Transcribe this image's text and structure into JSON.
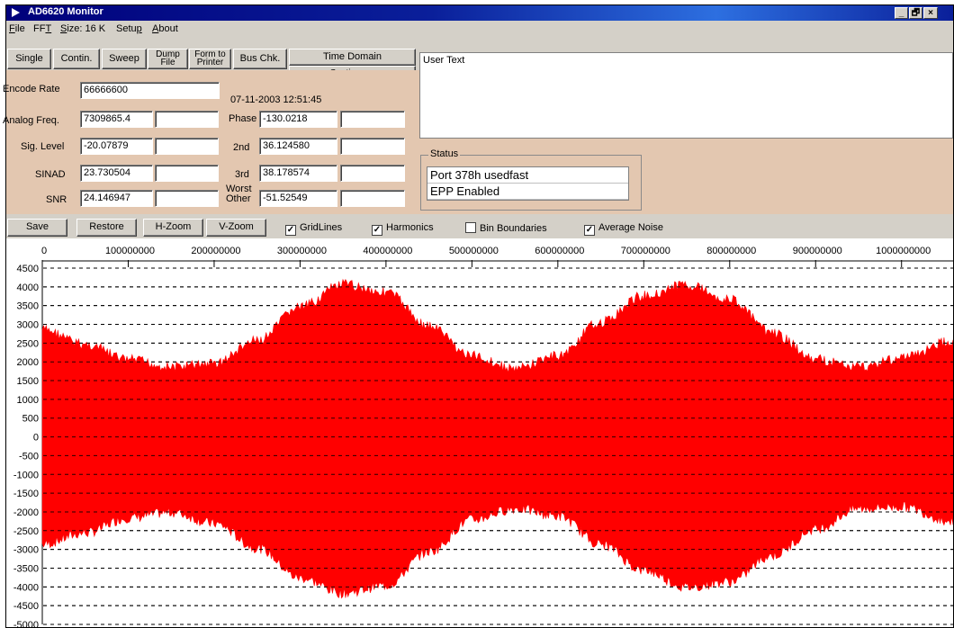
{
  "window": {
    "title": "AD6620 Monitor",
    "controls": [
      "_",
      "🗗",
      "×"
    ]
  },
  "menu": {
    "items": [
      {
        "label": "File",
        "underline": "F"
      },
      {
        "label": "FFT",
        "underline": "T"
      },
      {
        "label": "Size: 16 K",
        "underline": "S"
      },
      {
        "label": "Setup",
        "underline": "p"
      },
      {
        "label": "About",
        "underline": "A"
      }
    ]
  },
  "toolbar": {
    "single": "Single",
    "contin": "Contin.",
    "sweep": "Sweep",
    "dump_line1": "Dump",
    "dump_line2": "File",
    "form_line1": "Form to",
    "form_line2": "Printer",
    "bus_chk": "Bus Chk.",
    "time_domain": "Time Domain",
    "continuous": "Continuous"
  },
  "params": {
    "encode_rate_label": "Encode Rate",
    "encode_rate_value": "66666600",
    "timestamp": "07-11-2003  12:51:45",
    "analog_freq_label": "Analog Freq.",
    "analog_freq_value": "7309865.4",
    "analog_freq_value2": "",
    "phase_label": "Phase",
    "phase_value": "-130.0218",
    "phase_value2": "",
    "sig_level_label": "Sig. Level",
    "sig_level_value": "-20.07879",
    "sig_level_value2": "",
    "second_label": "2nd",
    "second_value": "36.124580",
    "second_value2": "",
    "sinad_label": "SINAD",
    "sinad_value": "23.730504",
    "sinad_value2": "",
    "third_label": "3rd",
    "third_value": "38.178574",
    "third_value2": "",
    "snr_label": "SNR",
    "snr_value": "24.146947",
    "snr_value2": "",
    "worst_label_line1": "Worst",
    "worst_label_line2": "Other",
    "worst_value": "-51.52549",
    "worst_value2": ""
  },
  "user_text": "User Text",
  "status": {
    "title": "Status",
    "lines": [
      "Port 378h usedfast",
      "EPP Enabled"
    ]
  },
  "chart_toolbar": {
    "save": "Save",
    "restore": "Restore",
    "h_zoom": "H-Zoom",
    "v_zoom": "V-Zoom",
    "checkboxes": [
      {
        "label": "GridLines",
        "checked": true
      },
      {
        "label": "Harmonics",
        "checked": true
      },
      {
        "label": "Bin Boundaries",
        "checked": false
      },
      {
        "label": "Average Noise",
        "checked": true
      }
    ]
  },
  "chart_data": {
    "type": "area",
    "title": "",
    "xlabel": "",
    "ylabel": "",
    "xlim": [
      0,
      1060000000
    ],
    "ylim": [
      -5000,
      4500
    ],
    "x_ticks": [
      0,
      100000000,
      200000000,
      300000000,
      400000000,
      500000000,
      600000000,
      700000000,
      800000000,
      900000000,
      1000000000
    ],
    "x_tick_labels": [
      "0",
      "100000000",
      "200000000",
      "300000000",
      "400000000",
      "500000000",
      "600000000",
      "700000000",
      "800000000",
      "900000000",
      "1000000000"
    ],
    "y_ticks": [
      4500,
      4000,
      3500,
      3000,
      2500,
      2000,
      1500,
      1000,
      500,
      0,
      -500,
      -1000,
      -1500,
      -2000,
      -2500,
      -3000,
      -3500,
      -4000,
      -4500,
      -5000
    ],
    "y_tick_labels": [
      "4500",
      "4000",
      "3500",
      "3000",
      "2500",
      "2000",
      "1500",
      "1000",
      "500",
      "0",
      "-500",
      "-1000",
      "-1500",
      "-2000",
      "-2500",
      "-3000",
      "-3500",
      "-4000",
      "-4500",
      "-5000"
    ],
    "grid": true,
    "series": [
      {
        "color": "#ff0000",
        "x": [
          0,
          50000000,
          100000000,
          150000000,
          200000000,
          250000000,
          300000000,
          350000000,
          400000000,
          450000000,
          500000000,
          550000000,
          600000000,
          650000000,
          700000000,
          750000000,
          800000000,
          850000000,
          900000000,
          950000000,
          1000000000,
          1060000000
        ],
        "upper": [
          3000,
          2600,
          2200,
          2000,
          2100,
          2700,
          3600,
          4200,
          4000,
          3100,
          2300,
          1950,
          2300,
          3200,
          3900,
          4200,
          3800,
          2900,
          2200,
          2000,
          2250,
          2700
        ],
        "lower": [
          -3000,
          -2700,
          -2300,
          -2150,
          -2450,
          -3100,
          -3900,
          -4300,
          -4100,
          -3200,
          -2350,
          -2050,
          -2250,
          -3000,
          -3700,
          -4150,
          -4000,
          -3300,
          -2600,
          -2050,
          -2000,
          -2400
        ]
      }
    ]
  }
}
